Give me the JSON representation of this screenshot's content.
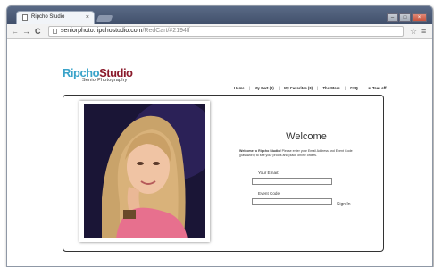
{
  "browser": {
    "tab_title": "Ripcho Studio",
    "tab_close": "×",
    "url_host": "seniorphoto.ripchostudio.com",
    "url_path": "/RedCart/#2194ff",
    "back": "←",
    "forward": "→",
    "reload": "C",
    "star": "☆",
    "menu": "≡",
    "win_min": "–",
    "win_max": "□",
    "win_close": "×"
  },
  "logo": {
    "part1": "Ripcho",
    "part2": "Studio",
    "tagline": "SeniorPhotography"
  },
  "nav": {
    "home": "Home",
    "cart": "My Cart (0)",
    "favorites": "My Favorites (0)",
    "store": "The Store",
    "faq": "FAQ",
    "tour": "Tour off",
    "sep": "|",
    "tour_bullet": "■"
  },
  "welcome": {
    "title": "Welcome",
    "intro_bold": "Welcome to Ripcho Studio!",
    "intro_rest": " Please enter your Email Address and Event Code (password) to see your proofs and place online orders."
  },
  "form": {
    "email_label": "Your Email:",
    "event_label": "Event Code:",
    "email_value": "",
    "event_value": "",
    "signin_label": "Sign In"
  },
  "colors": {
    "logo_blue": "#3aa3c9",
    "logo_maroon": "#8a1a2b",
    "photo_backdrop": "#2a1f55"
  }
}
